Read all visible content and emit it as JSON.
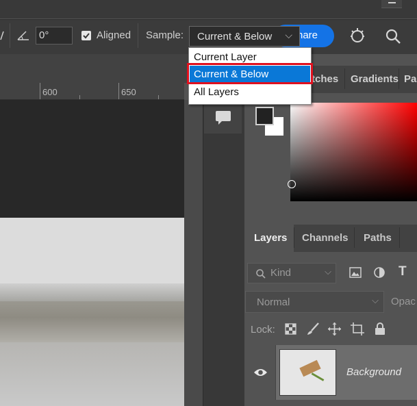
{
  "options_bar": {
    "angle_value": "0°",
    "aligned_label": "Aligned",
    "sample_label": "Sample:",
    "sample_value": "Current & Below",
    "share_label": "hare"
  },
  "sample_dropdown": {
    "options": [
      "Current Layer",
      "Current & Below",
      "All Layers"
    ],
    "selected_index": 1
  },
  "ruler": {
    "labels": [
      "600",
      "650"
    ]
  },
  "panel_tabs": [
    "tches",
    "Gradients",
    "Pa"
  ],
  "layers_panel": {
    "tabs": [
      "Layers",
      "Channels",
      "Paths"
    ],
    "active_tab": "Layers",
    "kind_placeholder": "Kind",
    "blend_mode": "Normal",
    "opacity_label": "Opac",
    "lock_label": "Lock:",
    "layer_name": "Background"
  },
  "colors": {
    "accent": "#1473e6",
    "selection": "#0a78d7",
    "highlight_box": "#e0101e",
    "foreground_swatch": "#222222",
    "background_swatch": "#ffffff"
  }
}
